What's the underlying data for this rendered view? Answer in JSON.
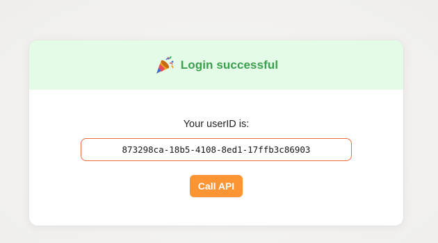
{
  "banner": {
    "icon": "party-popper-icon",
    "title": "Login successful",
    "title_color": "#3aa04e",
    "background_color": "#e4fbe8"
  },
  "main": {
    "userid_label": "Your userID is:",
    "userid_value": "873298ca-18b5-4108-8ed1-17ffb3c86903",
    "call_api_label": "Call API"
  },
  "colors": {
    "accent_button": "#fb9433",
    "id_border": "#ea6a3a"
  }
}
